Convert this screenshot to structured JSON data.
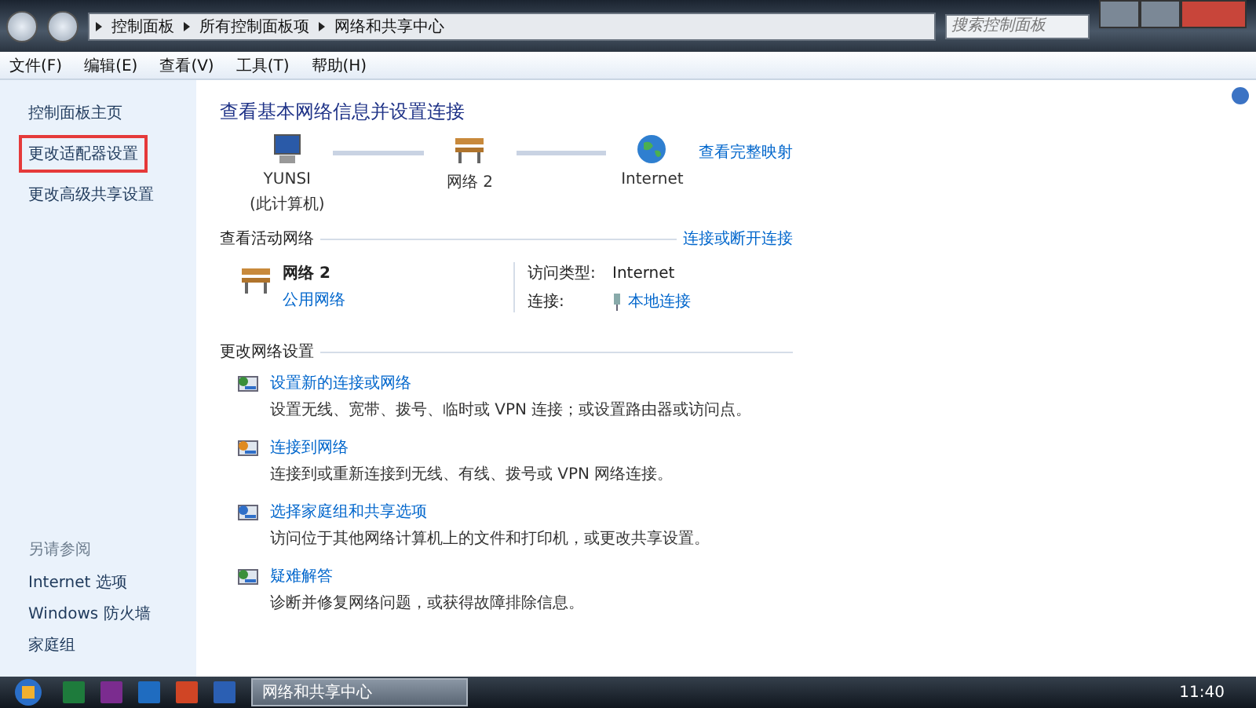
{
  "address_bar": {
    "crumbs": [
      "控制面板",
      "所有控制面板项",
      "网络和共享中心"
    ]
  },
  "search": {
    "placeholder": "搜索控制面板"
  },
  "menu_bar": [
    "文件(F)",
    "编辑(E)",
    "查看(V)",
    "工具(T)",
    "帮助(H)"
  ],
  "sidebar": {
    "items": [
      {
        "label": "控制面板主页",
        "highlighted": false
      },
      {
        "label": "更改适配器设置",
        "highlighted": true
      },
      {
        "label": "更改高级共享设置",
        "highlighted": false
      }
    ],
    "see_also_title": "另请参阅",
    "see_also": [
      "Internet 选项",
      "Windows 防火墙",
      "家庭组"
    ]
  },
  "main": {
    "title": "查看基本网络信息并设置连接",
    "full_map_link": "查看完整映射",
    "map": [
      {
        "kind": "computer",
        "label": "YUNSI",
        "sublabel": "(此计算机)"
      },
      {
        "kind": "network",
        "label": "网络  2"
      },
      {
        "kind": "internet",
        "label": "Internet"
      }
    ],
    "active_title": "查看活动网络",
    "connect_link": "连接或断开连接",
    "active_network": {
      "name": "网络  2",
      "type": "公用网络",
      "access_label": "访问类型:",
      "access_value": "Internet",
      "connection_label": "连接:",
      "connection_value": "本地连接"
    },
    "settings_title": "更改网络设置",
    "tasks": [
      {
        "kind": "new",
        "title": "设置新的连接或网络",
        "description": "设置无线、宽带、拨号、临时或 VPN 连接；或设置路由器或访问点。"
      },
      {
        "kind": "connect",
        "title": "连接到网络",
        "description": "连接到或重新连接到无线、有线、拨号或 VPN 网络连接。"
      },
      {
        "kind": "homegroup",
        "title": "选择家庭组和共享选项",
        "description": "访问位于其他网络计算机上的文件和打印机，或更改共享设置。"
      },
      {
        "kind": "troubleshoot",
        "title": "疑难解答",
        "description": "诊断并修复网络问题，或获得故障排除信息。"
      }
    ]
  },
  "taskbar": {
    "apps": [
      {
        "color": "#1e7b3c"
      },
      {
        "color": "#7b2c8f"
      },
      {
        "color": "#1f6cc0"
      },
      {
        "color": "#d04525"
      },
      {
        "color": "#2b5fb3"
      }
    ],
    "window_button": "网络和共享中心",
    "clock": "11:40"
  }
}
